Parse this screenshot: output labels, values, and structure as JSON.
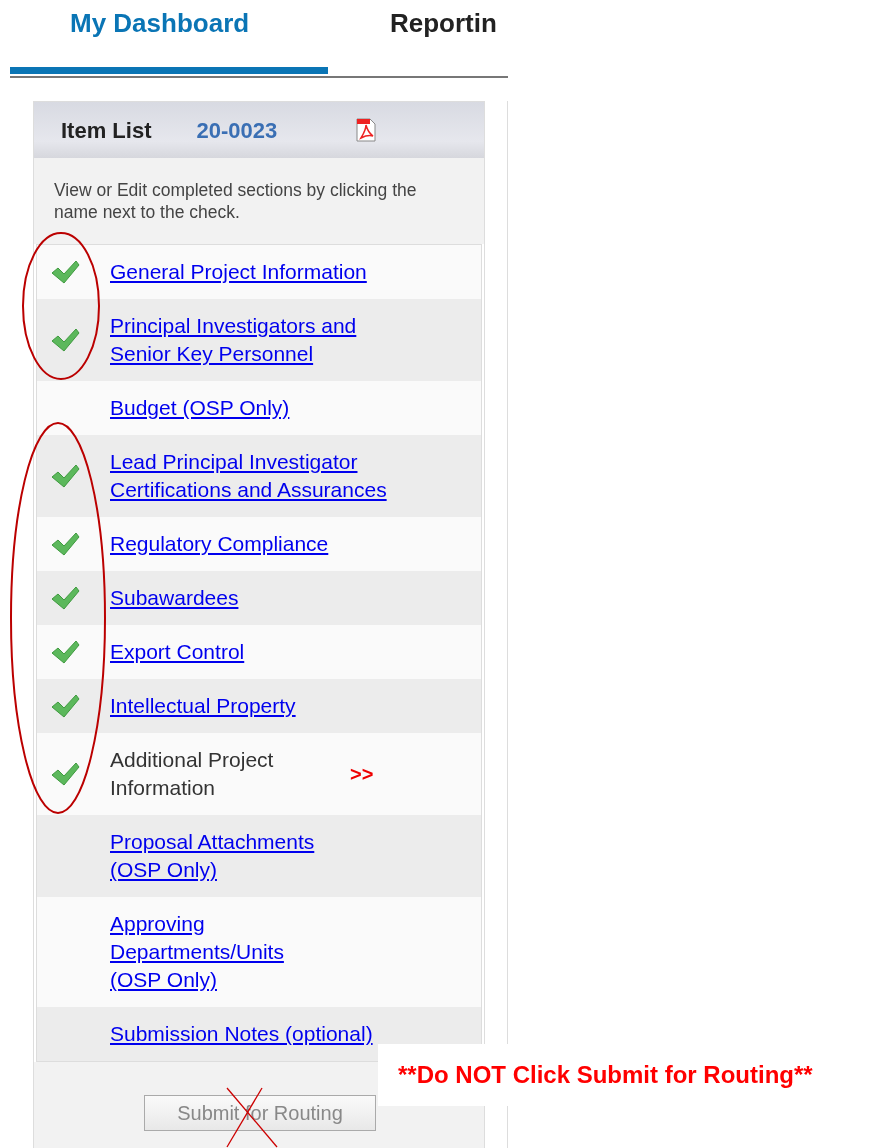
{
  "tabs": [
    {
      "label": "My Dashboard",
      "selected": true
    },
    {
      "label": "Reportin",
      "selected": false
    }
  ],
  "item_list": {
    "title": "Item List",
    "number": "20-0023",
    "instructions": "View or Edit completed sections by clicking the name next to the check.",
    "items": [
      {
        "label": "General Project Information",
        "kind": "link",
        "checked": true,
        "circled": true
      },
      {
        "label": "Principal Investigators and Senior Key Personnel",
        "kind": "link",
        "checked": true,
        "circled": true
      },
      {
        "label": "Budget (OSP Only)",
        "kind": "link",
        "checked": false,
        "circled": false
      },
      {
        "label": "Lead Principal Investigator Certifications and Assurances",
        "kind": "link",
        "checked": true,
        "circled": true
      },
      {
        "label": "Regulatory Compliance",
        "kind": "link",
        "checked": true,
        "circled": true
      },
      {
        "label": "Subawardees",
        "kind": "link",
        "checked": true,
        "circled": true
      },
      {
        "label": "Export Control",
        "kind": "link",
        "checked": true,
        "circled": true
      },
      {
        "label": "Intellectual Property",
        "kind": "link",
        "checked": true,
        "circled": true
      },
      {
        "label": "Additional Project Information",
        "kind": "current",
        "checked": true,
        "circled": true,
        "marker": ">>"
      },
      {
        "label": "Proposal Attachments (OSP Only)",
        "kind": "link",
        "checked": false,
        "circled": false
      },
      {
        "label": "Approving Departments/Units (OSP Only)",
        "kind": "link",
        "checked": false,
        "circled": false
      },
      {
        "label": "Submission Notes (optional)",
        "kind": "link",
        "checked": false,
        "circled": false
      }
    ],
    "submit_button": {
      "label": "Submit for Routing",
      "crossed_out": true
    }
  },
  "note": "**Do NOT Click Submit for Routing**"
}
